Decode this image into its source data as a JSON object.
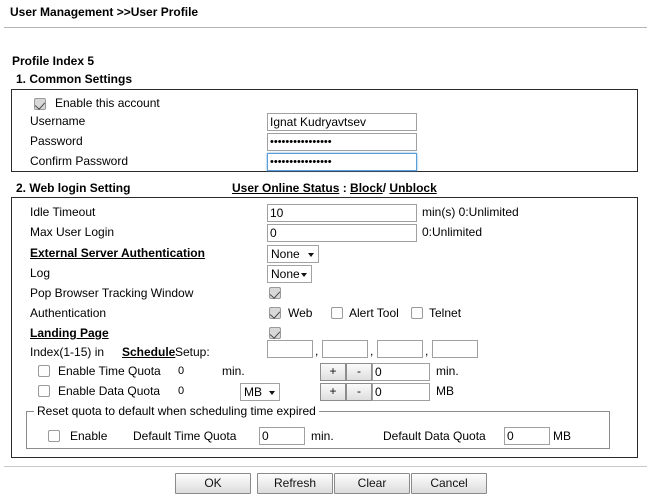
{
  "breadcrumb": "User Management >>User Profile",
  "profile_index": "Profile Index 5",
  "section1": {
    "title": "1. Common Settings",
    "enable_account_label": "Enable this account",
    "enable_account_checked": true,
    "username_label": "Username",
    "username_value": "Ignat Kudryavtsev",
    "password_label": "Password",
    "password_value": "••••••••••••••••",
    "confirm_password_label": "Confirm Password",
    "confirm_password_value": "••••••••••••••••"
  },
  "section2": {
    "title": "2. Web login Setting",
    "online_status_label": "User Online Status",
    "online_status_sep": " : ",
    "block_link": "Block",
    "slash": "/ ",
    "unblock_link": "Unblock",
    "idle_timeout_label": "Idle Timeout",
    "idle_timeout_value": "10",
    "idle_timeout_hint": "min(s) 0:Unlimited",
    "max_user_login_label": "Max User Login",
    "max_user_login_value": "0",
    "max_user_login_hint": "0:Unlimited",
    "external_auth_label": "External Server Authentication",
    "external_auth_value": "None",
    "log_label": "Log",
    "log_value": "None",
    "pop_browser_label": "Pop Browser Tracking Window",
    "pop_browser_checked": true,
    "authentication_label": "Authentication",
    "auth_web_label": "Web",
    "auth_web_checked": true,
    "auth_alert_label": "Alert Tool",
    "auth_alert_checked": false,
    "auth_telnet_label": "Telnet",
    "auth_telnet_checked": false,
    "landing_page_label": "Landing Page",
    "landing_page_checked": true,
    "schedule_prefix": "Index(1-15) in",
    "schedule_link": "Schedule",
    "schedule_suffix": "Setup:",
    "schedule_values": [
      "",
      "",
      "",
      ""
    ],
    "schedule_comma": ",",
    "time_quota_label": "Enable Time Quota",
    "time_quota_checked": false,
    "time_quota_used": "0",
    "time_quota_unit1": "min.",
    "time_quota_plus": "+",
    "time_quota_minus": "-",
    "time_quota_value": "0",
    "time_quota_unit2": "min.",
    "data_quota_label": "Enable Data Quota",
    "data_quota_checked": false,
    "data_quota_used": "0",
    "data_quota_select": "MB",
    "data_quota_plus": "+",
    "data_quota_minus": "-",
    "data_quota_value": "0",
    "data_quota_unit": "MB",
    "reset_legend": "Reset quota to default when scheduling time expired",
    "reset_enable_label": "Enable",
    "reset_enable_checked": false,
    "default_time_quota_label": "Default Time Quota",
    "default_time_quota_value": "0",
    "default_time_quota_unit": "min.",
    "default_data_quota_label": "Default Data Quota",
    "default_data_quota_value": "0",
    "default_data_quota_unit": "MB"
  },
  "footer": {
    "ok": "OK",
    "refresh": "Refresh",
    "clear": "Clear",
    "cancel": "Cancel"
  },
  "colors": {
    "focus_border": "#5b9dd9",
    "box_border": "#2b2b2b",
    "divider": "#b4b4b4"
  }
}
